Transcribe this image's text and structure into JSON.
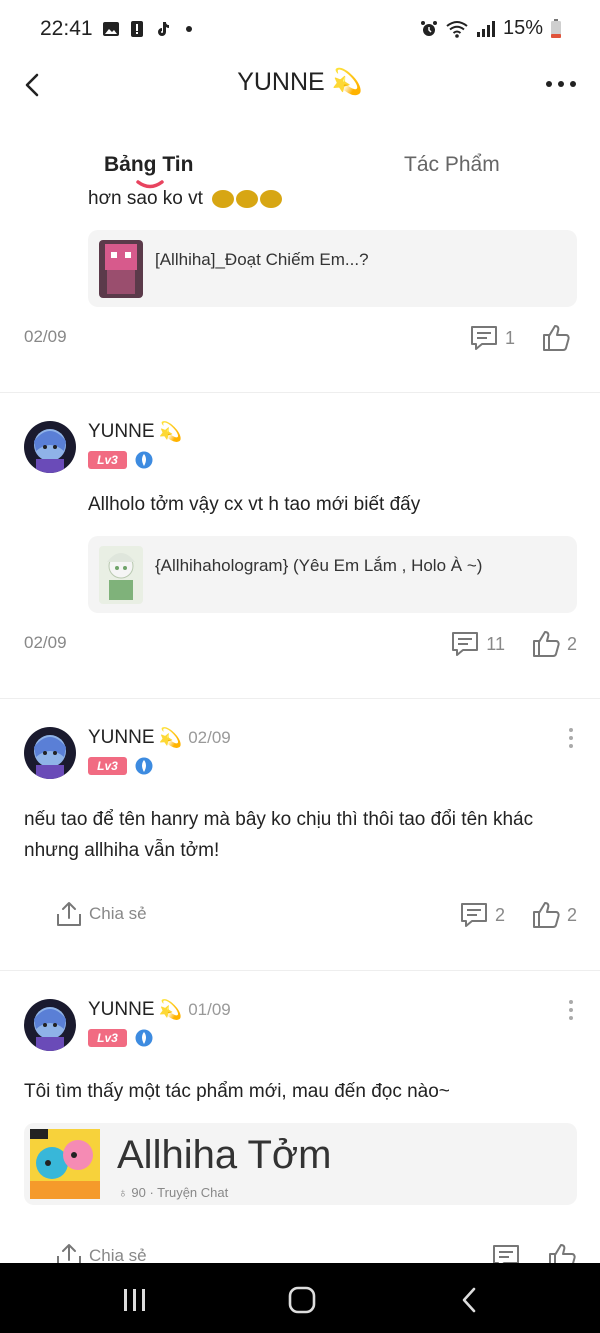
{
  "status_bar": {
    "time": "22:41",
    "battery": "15%"
  },
  "header": {
    "title": "YUNNE",
    "title_emoji": "💫"
  },
  "tabs": [
    {
      "label": "Bảng Tin"
    },
    {
      "label": "Tác Phẩm"
    }
  ],
  "feed": {
    "partial_post": {
      "text_fragment": "hơn sao ko vt",
      "card_title": "[Allhiha]_Đoạt Chiếm Em...?",
      "date": "02/09",
      "comments": "1",
      "likes": ""
    },
    "posts": [
      {
        "username": "YUNNE",
        "level": "Lv3",
        "date_inline": "",
        "text": "Allholo tởm vậy cx vt h tao mới biết đấy",
        "card_title": "{Allhihahologram} (Yêu Em Lắm , Holo À ~)",
        "date": "02/09",
        "comments": "11",
        "likes": "2"
      },
      {
        "username": "YUNNE",
        "level": "Lv3",
        "date_inline": "02/09",
        "text_line1": "nếu tao để tên hanry mà bây ko chịu thì thôi tao đổi tên khác",
        "text_line2": "nhưng allhiha vẫn tởm!",
        "share": "Chia sẻ",
        "comments": "2",
        "likes": "2"
      },
      {
        "username": "YUNNE",
        "level": "Lv3",
        "date_inline": "01/09",
        "text": "Tôi tìm thấy một tác phẩm mới, mau đến đọc nào~",
        "book_title": "Allhiha Tởm",
        "book_views": "90",
        "book_type": "Truyện Chat",
        "share": "Chia sẻ"
      }
    ]
  },
  "colors": {
    "accent": "#f16b82",
    "tab_indicator": "#e8445f",
    "card_bg": "#f4f4f4",
    "muted": "#888888"
  }
}
